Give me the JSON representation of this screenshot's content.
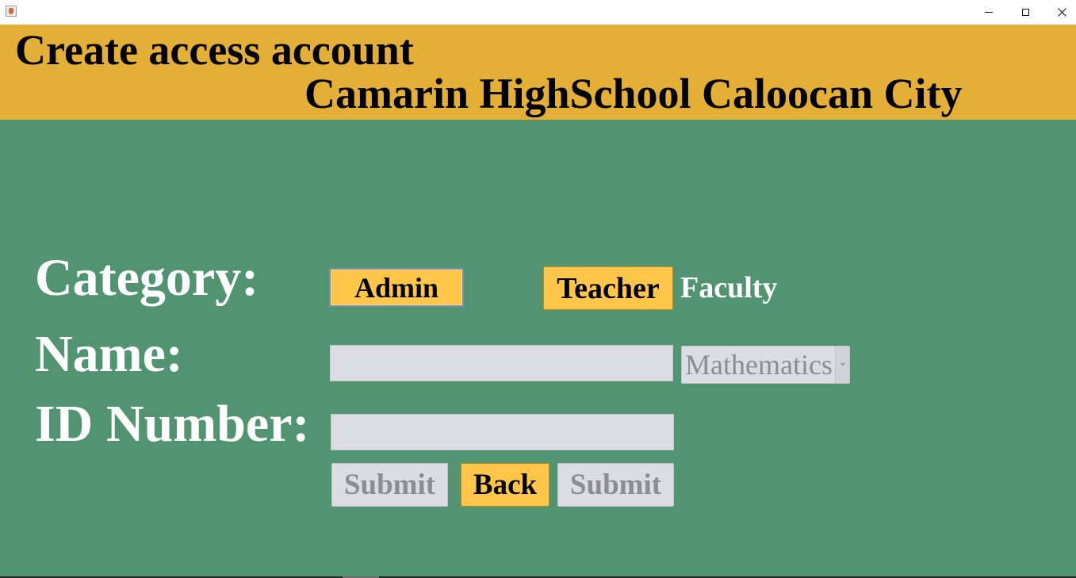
{
  "window": {
    "controls": {
      "minimize": "minimize-icon",
      "maximize": "maximize-icon",
      "close": "close-icon"
    }
  },
  "header": {
    "title": "Create access account",
    "subtitle": "Camarin HighSchool Caloocan City",
    "background": "#e3af36"
  },
  "form": {
    "background": "#529471",
    "category_label": "Category:",
    "name_label": "Name:",
    "id_label": "ID Number:",
    "faculty_label": "Faculty",
    "admin_button": "Admin",
    "teacher_button": "Teacher",
    "name_value": "",
    "id_value": "",
    "department_selected": "Mathematics",
    "submit_button_1": "Submit",
    "back_button": "Back",
    "submit_button_2": "Submit",
    "button_color": "#ffc64a",
    "disabled_color": "#dcdde3"
  }
}
